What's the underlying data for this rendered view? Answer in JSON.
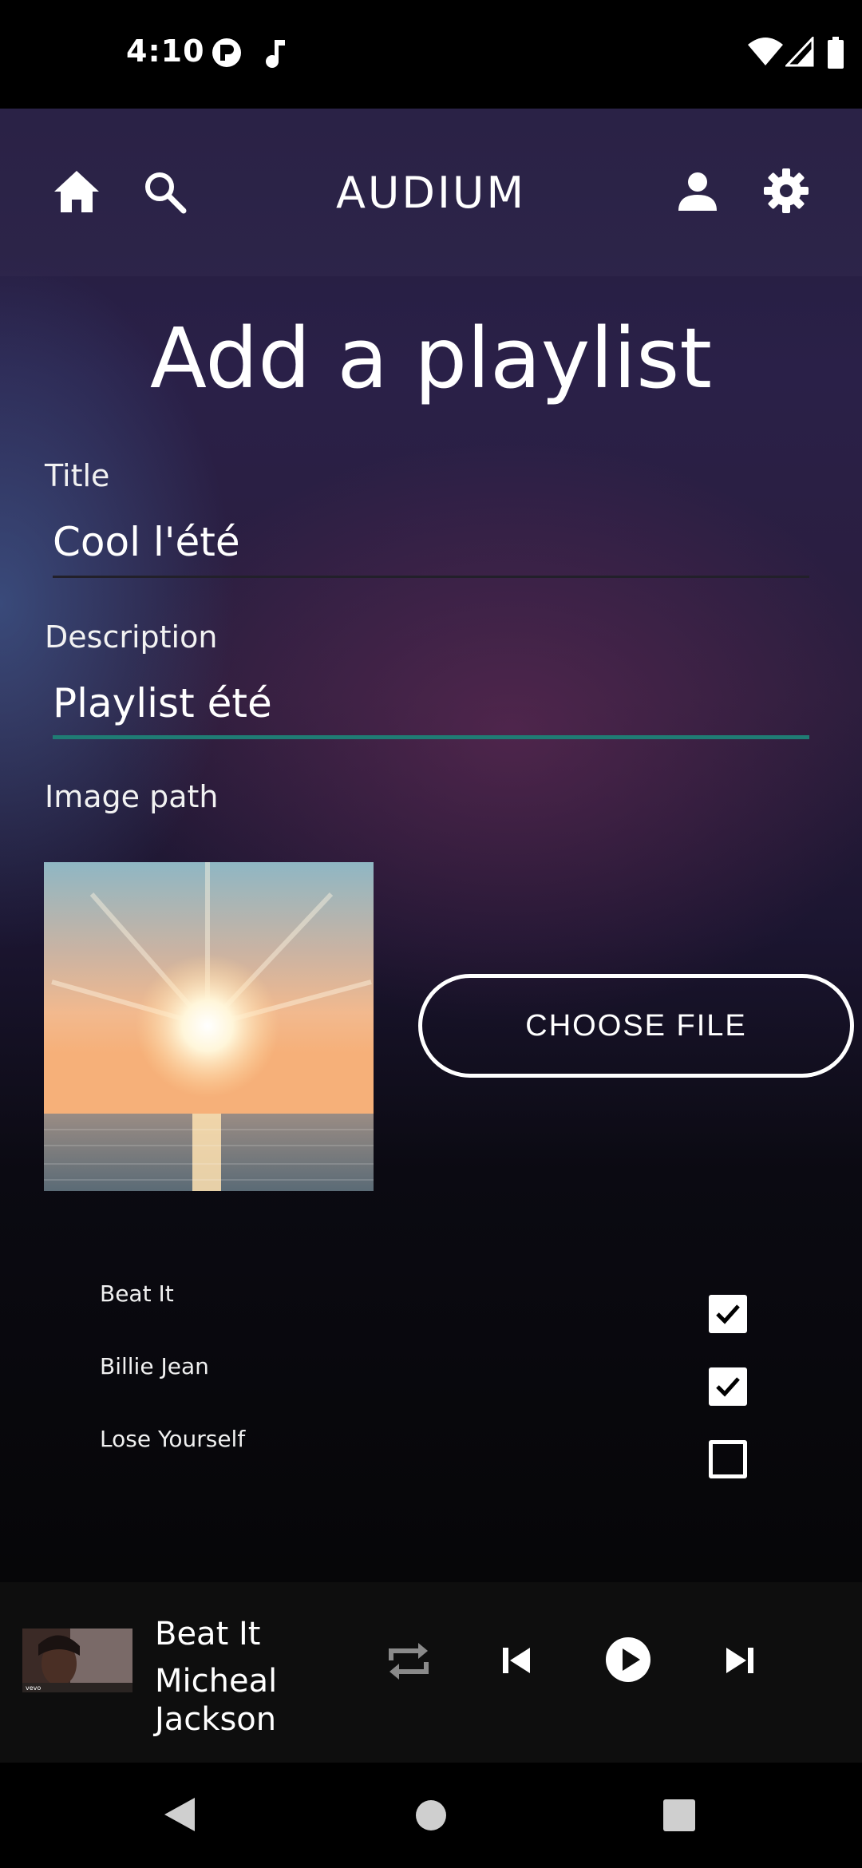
{
  "status_bar": {
    "time": "4:10",
    "left_icons": [
      "app-notification-icon",
      "music-note-icon"
    ],
    "right_icons": [
      "wifi-icon",
      "cell-signal-icon",
      "battery-icon"
    ]
  },
  "header": {
    "app_name": "AUDIUM",
    "left_icons": [
      "home-icon",
      "search-icon"
    ],
    "right_icons": [
      "account-icon",
      "settings-gear-icon"
    ]
  },
  "form": {
    "page_title": "Add a playlist",
    "title_label": "Title",
    "title_value": "Cool l'été",
    "description_label": "Description",
    "description_value": "Playlist été",
    "image_label": "Image path",
    "choose_file_label": "CHOOSE FILE"
  },
  "songs": [
    {
      "title": "Beat It",
      "checked": true
    },
    {
      "title": "Billie Jean",
      "checked": true
    },
    {
      "title": "Lose Yourself",
      "checked": false
    }
  ],
  "player": {
    "track_title": "Beat It",
    "artist": "Micheal Jackson",
    "controls": [
      "repeat-icon",
      "skip-previous-icon",
      "play-icon",
      "skip-next-icon"
    ]
  },
  "system_nav": [
    "back-icon",
    "home-circle-icon",
    "recents-icon"
  ],
  "colors": {
    "accent_underline": "#1f7c74",
    "background_top": "#241d3e",
    "background_bottom": "#060608"
  }
}
